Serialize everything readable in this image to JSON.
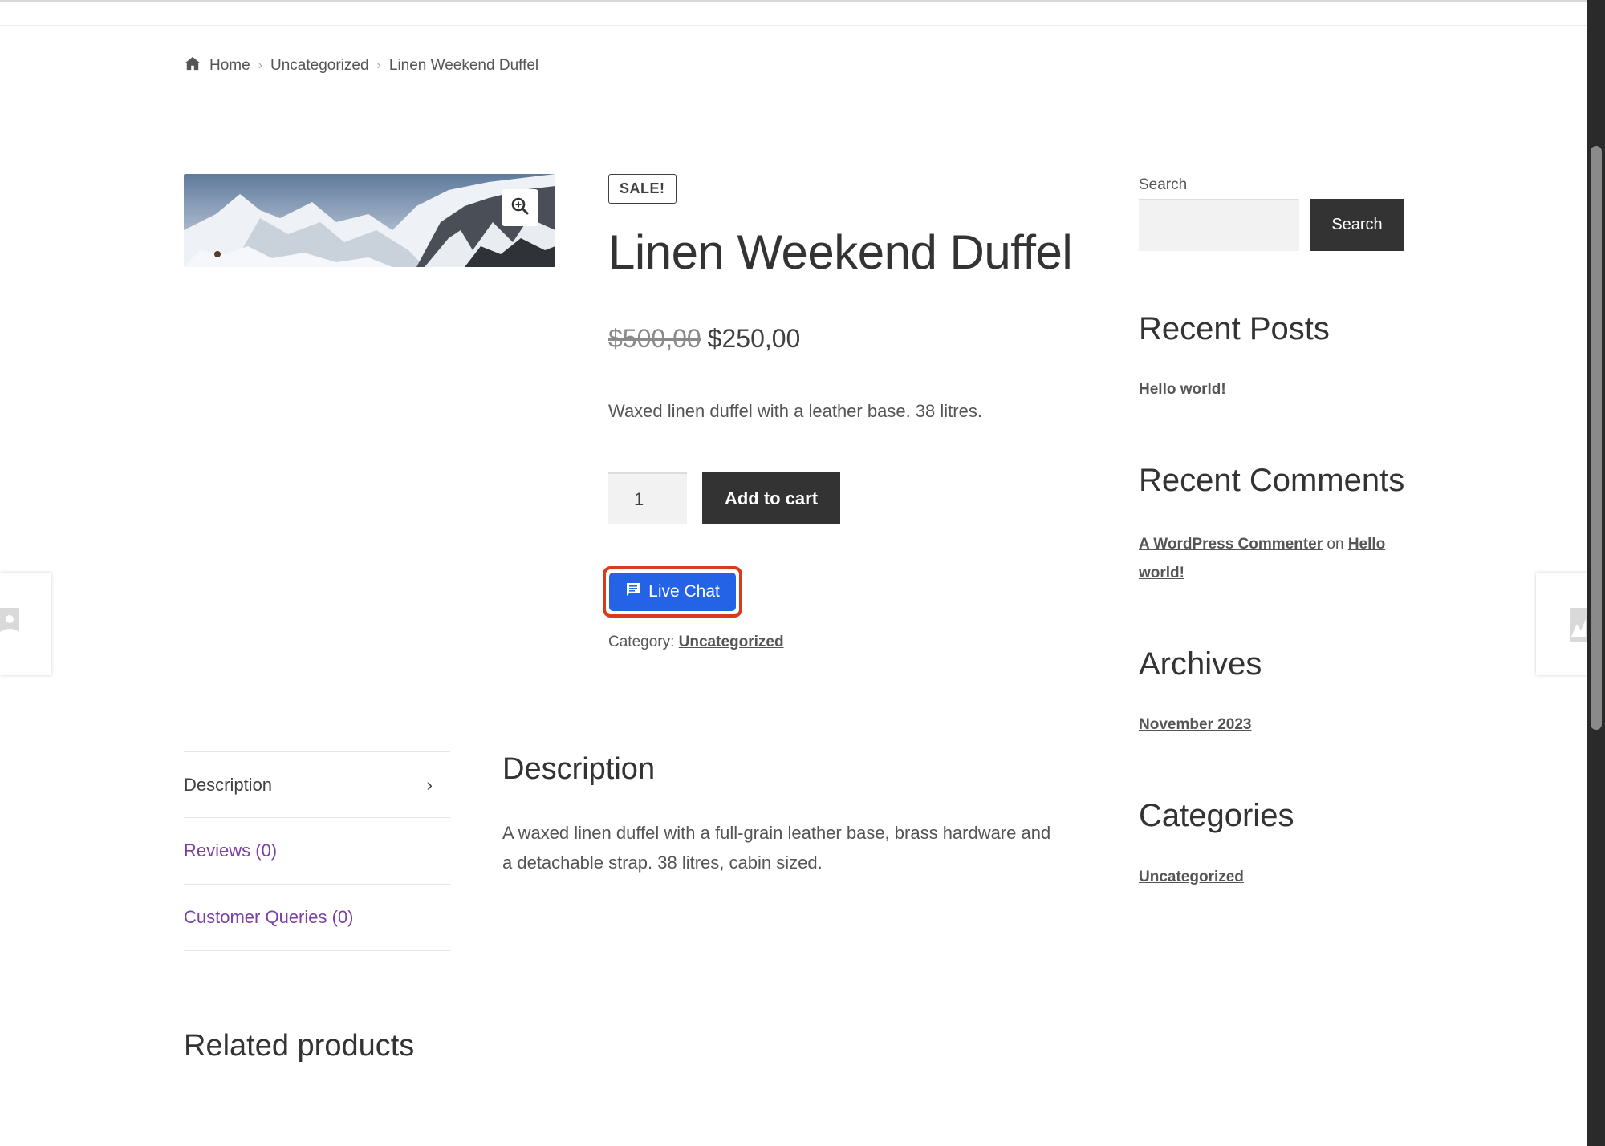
{
  "breadcrumb": {
    "home": "Home",
    "category": "Uncategorized",
    "current": "Linen Weekend Duffel"
  },
  "product": {
    "badge": "SALE!",
    "title": "Linen Weekend Duffel",
    "old_price": "$500,00",
    "price": "$250,00",
    "short_description": "Waxed linen duffel with a leather base. 38 litres.",
    "quantity": "1",
    "add_to_cart": "Add to cart",
    "live_chat": "Live Chat",
    "category_label": "Category:",
    "category": "Uncategorized"
  },
  "tabs": [
    {
      "label": "Description"
    },
    {
      "label": "Reviews (0)"
    },
    {
      "label": "Customer Queries (0)"
    }
  ],
  "description": {
    "heading": "Description",
    "text": "A waxed linen duffel with a full-grain leather base, brass hardware and a detachable strap. 38 litres, cabin sized."
  },
  "related": {
    "heading": "Related products"
  },
  "sidebar": {
    "search_label": "Search",
    "search_button": "Search",
    "recent_posts": {
      "title": "Recent Posts",
      "items": [
        "Hello world!"
      ]
    },
    "recent_comments": {
      "title": "Recent Comments",
      "author": "A WordPress Commenter",
      "on": "on",
      "post": "Hello world!"
    },
    "archives": {
      "title": "Archives",
      "items": [
        "November 2023"
      ]
    },
    "categories": {
      "title": "Categories",
      "items": [
        "Uncategorized"
      ]
    }
  },
  "colors": {
    "live_chat": "#2463e6",
    "highlight_ring": "#d93a1f",
    "tab_link": "#7c3fa6",
    "dark_button": "#333333"
  },
  "icons": [
    "home-icon",
    "zoom-icon",
    "chat-icon",
    "chevron-right-icon",
    "placeholder-image-icon"
  ]
}
